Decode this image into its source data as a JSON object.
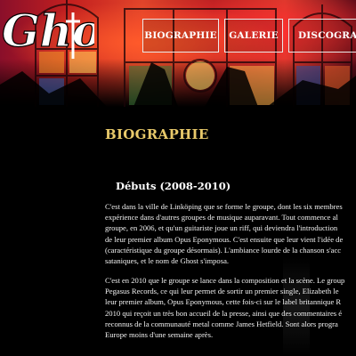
{
  "header": {
    "logo_text": "Ghost",
    "nav": [
      {
        "label": "BIOGRAPHIE"
      },
      {
        "label": "GALERIE"
      },
      {
        "label": "DISCOGRAPHIE"
      }
    ]
  },
  "main": {
    "page_title": "BIOGRAPHIE",
    "section_title": "Débuts (2008-2010)",
    "paragraph1": [
      "C'est dans la ville de Linköping que se forme le groupe, dont les six membres",
      "expérience dans d'autres groupes de musique auparavant. Tout commence al",
      "groupe, en 2006, et qu'un guitariste joue un riff, qui deviendra l'introduction",
      "de leur premier album Opus Eponymous. C'est ensuite que leur vient l'idée de",
      "(caractéristique du groupe désormais). L'ambiance lourde de la chanson s'acc",
      "sataniques, et le nom de Ghost s'imposa."
    ],
    "paragraph2": [
      "C'est en 2010 que le groupe se lance dans la composition et la scène. Le group",
      "Pegasus Records, ce qui leur permet de sortir un premier single, Elizabeth le",
      "leur premier album, Opus Eponymous, cette fois-ci sur le label britannique R",
      "2010 qui reçoit un très bon accueil de la presse, ainsi que des commentaires é",
      "reconnus de la communauté metal comme James Hetfield. Sont alors progra",
      "Europe moins d'une semaine après."
    ]
  },
  "colors": {
    "title_gold": "#e8c96a",
    "background": "#000000",
    "nav_border": "#e9e9e9"
  }
}
